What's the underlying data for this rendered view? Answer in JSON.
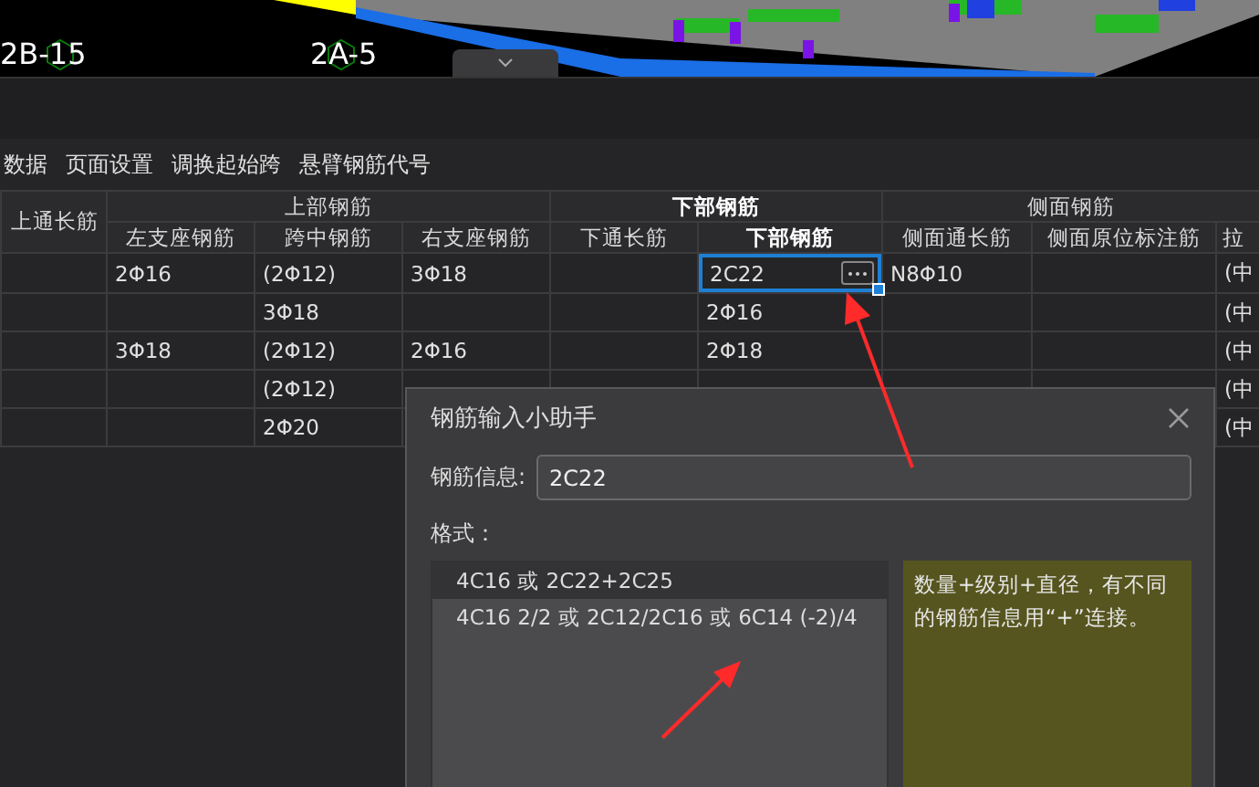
{
  "model_view": {
    "axis_labels": [
      "2B-15",
      "2A-5"
    ]
  },
  "toolbar": {
    "items": [
      "数据",
      "页面设置",
      "调换起始跨",
      "悬臂钢筋代号"
    ]
  },
  "table": {
    "groups": [
      {
        "label": "上通长筋",
        "selected": false
      },
      {
        "label": "上部钢筋",
        "selected": false,
        "columns": [
          {
            "label": "左支座钢筋",
            "selected": false
          },
          {
            "label": "跨中钢筋",
            "selected": false
          },
          {
            "label": "右支座钢筋",
            "selected": false
          }
        ]
      },
      {
        "label": "下部钢筋",
        "selected": true,
        "columns": [
          {
            "label": "下通长筋",
            "selected": false
          },
          {
            "label": "下部钢筋",
            "selected": true
          }
        ]
      },
      {
        "label": "侧面钢筋",
        "selected": false,
        "columns": [
          {
            "label": "侧面通长筋",
            "selected": false
          },
          {
            "label": "侧面原位标注筋",
            "selected": false
          },
          {
            "label": "拉",
            "selected": false
          }
        ]
      }
    ],
    "rows": [
      [
        null,
        "2Φ16",
        "(2Φ12)",
        "3Φ18",
        null,
        {
          "text": "2C22",
          "editing": true
        },
        "N8Φ10",
        null,
        "(中"
      ],
      [
        null,
        null,
        "3Φ18",
        null,
        null,
        "2Φ16",
        null,
        null,
        "(中"
      ],
      [
        null,
        "3Φ18",
        "(2Φ12)",
        "2Φ16",
        null,
        "2Φ18",
        null,
        null,
        "(中"
      ],
      [
        null,
        null,
        "(2Φ12)",
        null,
        null,
        null,
        null,
        null,
        "(中"
      ],
      [
        null,
        null,
        "2Φ20",
        null,
        null,
        null,
        null,
        null,
        "(中"
      ]
    ]
  },
  "dialog": {
    "title": "钢筋输入小助手",
    "field_label": "钢筋信息:",
    "field_value": "2C22",
    "format_label": "格式：",
    "formats": [
      {
        "text": "4C16 或 2C22+2C25",
        "selected": true
      },
      {
        "text": "4C16 2/2 或 2C12/2C16 或 6C14 (-2)/4",
        "selected": false
      }
    ],
    "hint": "数量+级别+直径，有不同的钢筋信息用“+”连接。"
  }
}
